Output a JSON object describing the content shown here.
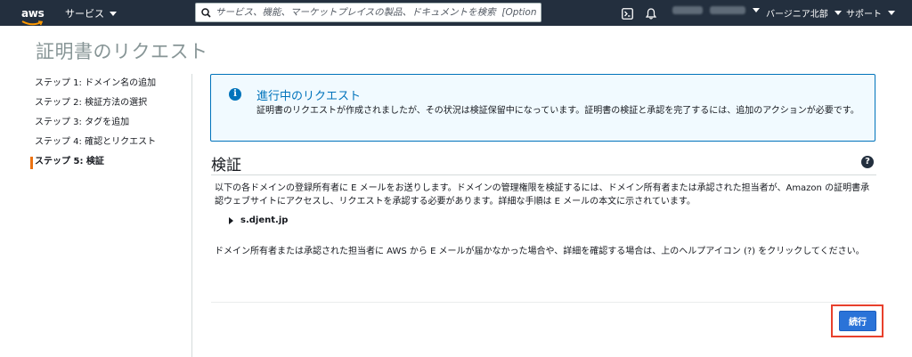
{
  "topnav": {
    "logo_text": "aws",
    "services_label": "サービス",
    "search_placeholder": "サービス、機能、マーケットプレイスの製品、ドキュメントを検索  [Option+S]",
    "region_label": "バージニア北部",
    "support_label": "サポート"
  },
  "page": {
    "title": "証明書のリクエスト"
  },
  "steps": [
    {
      "label": "ステップ 1: ドメイン名の追加"
    },
    {
      "label": "ステップ 2: 検証方法の選択"
    },
    {
      "label": "ステップ 3: タグを追加"
    },
    {
      "label": "ステップ 4: 確認とリクエスト"
    },
    {
      "label": "ステップ 5: 検証"
    }
  ],
  "alert": {
    "title": "進行中のリクエスト",
    "body": "証明書のリクエストが作成されましたが、その状況は検証保留中になっています。証明書の検証と承認を完了するには、追加のアクションが必要です。"
  },
  "verify": {
    "title": "検証",
    "body": "以下の各ドメインの登録所有者に E メールをお送りします。ドメインの管理権限を検証するには、ドメイン所有者または承認された担当者が、Amazon の証明書承認ウェブサイトにアクセスし、リクエストを承認する必要があります。詳細な手順は E メールの本文に示されています。",
    "domain": "s.djent.jp",
    "note": "ドメイン所有者または承認された担当者に AWS から E メールが届かなかった場合や、詳細を確認する場合は、上のヘルプアイコン (?) をクリックしてください。"
  },
  "actions": {
    "continue_label": "続行"
  },
  "colors": {
    "nav_bg": "#232f3e",
    "accent_orange": "#ec7211",
    "info_blue": "#0073bb",
    "alert_bg": "#f1faff",
    "primary_button": "#2a73d8",
    "highlight_red": "#e8402c"
  },
  "icons": {
    "search": "search-icon",
    "terminal": "cloudshell-icon",
    "bell": "bell-icon",
    "info": "info-icon",
    "help": "help-icon"
  }
}
